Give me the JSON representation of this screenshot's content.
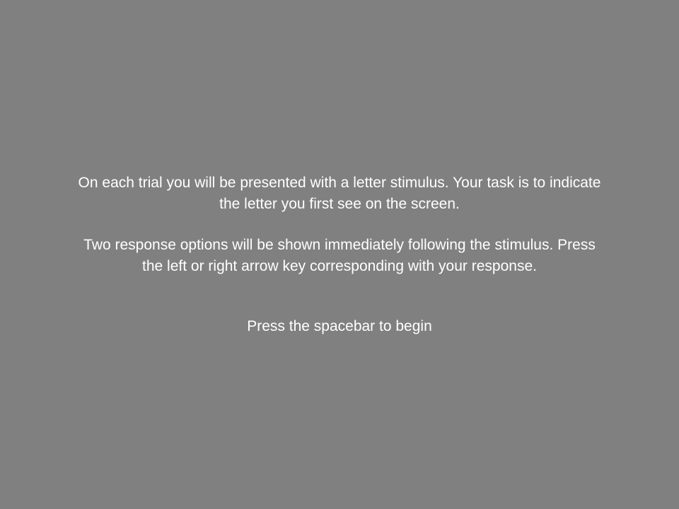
{
  "instructions": {
    "paragraph_1": "On each trial you will be presented with a letter stimulus.  Your task is to indicate\nthe letter you first see on the screen.",
    "paragraph_2": "Two response options will be shown immediately following the stimulus.  Press\nthe left or right arrow key corresponding with your response."
  },
  "prompt": {
    "text": "Press the spacebar to begin"
  },
  "colors": {
    "background": "#808080",
    "text": "#ffffff"
  }
}
